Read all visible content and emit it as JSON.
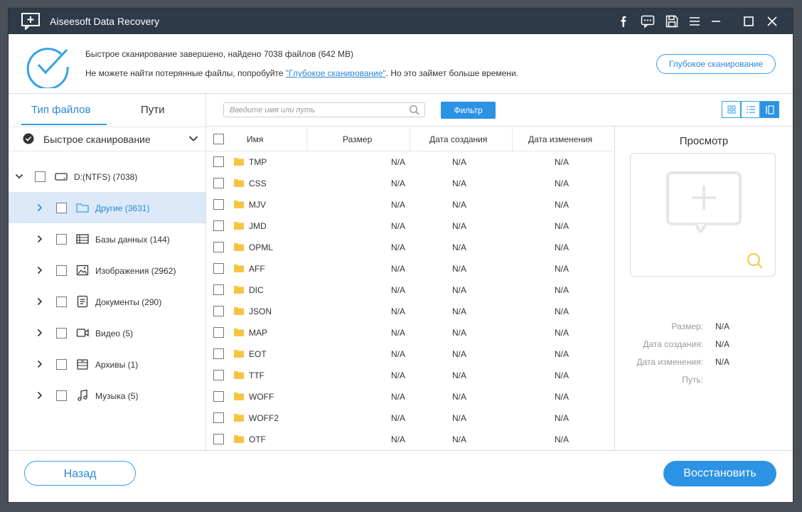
{
  "app": {
    "title": "Aiseesoft Data Recovery"
  },
  "header": {
    "status_line": "Быстрое сканирование завершено, найдено 7038 файлов (642 MB)",
    "hint_prefix": "Не можете найти потерянные файлы, попробуйте ",
    "hint_link": "\"Глубокое сканирование\"",
    "hint_suffix": ". Но это займет больше времени.",
    "deep_scan_button": "Глубокое сканирование"
  },
  "sidebar": {
    "tabs": [
      "Тип файлов",
      "Пути"
    ],
    "scan_mode": "Быстрое сканирование",
    "drive": "D:(NTFS) (7038)",
    "items": [
      {
        "label": "Другие (3631)",
        "icon": "folder-icon",
        "selected": true
      },
      {
        "label": "Базы данных (144)",
        "icon": "database-icon",
        "selected": false
      },
      {
        "label": "Изображения (2962)",
        "icon": "image-icon",
        "selected": false
      },
      {
        "label": "Документы (290)",
        "icon": "document-icon",
        "selected": false
      },
      {
        "label": "Видео (5)",
        "icon": "video-icon",
        "selected": false
      },
      {
        "label": "Архивы (1)",
        "icon": "archive-icon",
        "selected": false
      },
      {
        "label": "Музыка (5)",
        "icon": "music-icon",
        "selected": false
      }
    ]
  },
  "toolbar": {
    "search_placeholder": "Введите имя или путь",
    "filter_button": "Фильтр"
  },
  "table": {
    "columns": [
      "Имя",
      "Размер",
      "Дата создания",
      "Дата изменения"
    ],
    "rows": [
      {
        "name": "TMP",
        "size": "N/A",
        "created": "N/A",
        "modified": "N/A"
      },
      {
        "name": "CSS",
        "size": "N/A",
        "created": "N/A",
        "modified": "N/A"
      },
      {
        "name": "MJV",
        "size": "N/A",
        "created": "N/A",
        "modified": "N/A"
      },
      {
        "name": "JMD",
        "size": "N/A",
        "created": "N/A",
        "modified": "N/A"
      },
      {
        "name": "OPML",
        "size": "N/A",
        "created": "N/A",
        "modified": "N/A"
      },
      {
        "name": "AFF",
        "size": "N/A",
        "created": "N/A",
        "modified": "N/A"
      },
      {
        "name": "DIC",
        "size": "N/A",
        "created": "N/A",
        "modified": "N/A"
      },
      {
        "name": "JSON",
        "size": "N/A",
        "created": "N/A",
        "modified": "N/A"
      },
      {
        "name": "MAP",
        "size": "N/A",
        "created": "N/A",
        "modified": "N/A"
      },
      {
        "name": "EOT",
        "size": "N/A",
        "created": "N/A",
        "modified": "N/A"
      },
      {
        "name": "TTF",
        "size": "N/A",
        "created": "N/A",
        "modified": "N/A"
      },
      {
        "name": "WOFF",
        "size": "N/A",
        "created": "N/A",
        "modified": "N/A"
      },
      {
        "name": "WOFF2",
        "size": "N/A",
        "created": "N/A",
        "modified": "N/A"
      },
      {
        "name": "OTF",
        "size": "N/A",
        "created": "N/A",
        "modified": "N/A"
      }
    ]
  },
  "preview": {
    "title": "Просмотр",
    "size_label": "Размер:",
    "size_value": "N/A",
    "created_label": "Дата создания:",
    "created_value": "N/A",
    "modified_label": "Дата изменения:",
    "modified_value": "N/A",
    "path_label": "Путь:",
    "path_value": ""
  },
  "footer": {
    "back_button": "Назад",
    "restore_button": "Восстановить"
  },
  "colors": {
    "accent": "#2b92e4",
    "titlebar": "#2f3a48",
    "selected_row": "#dbe9f8",
    "folder": "#f5c542"
  }
}
